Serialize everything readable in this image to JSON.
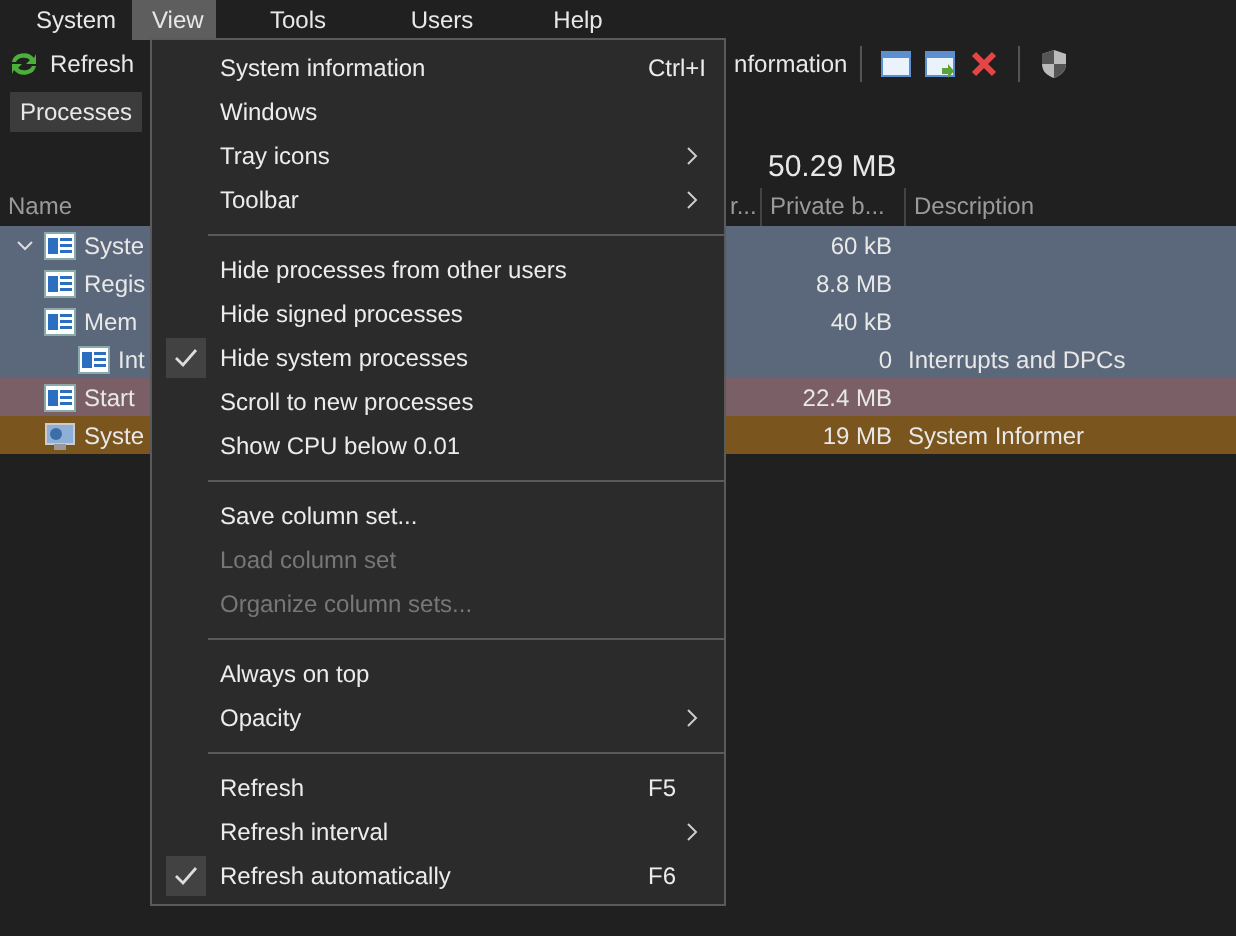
{
  "menu_bar": [
    {
      "label": "System",
      "selected": false
    },
    {
      "label": "View",
      "selected": true
    },
    {
      "label": "Tools",
      "selected": false
    },
    {
      "label": "Users",
      "selected": false
    },
    {
      "label": "Help",
      "selected": false
    }
  ],
  "toolbar": {
    "refresh": "Refresh",
    "info": "nformation"
  },
  "tabs": [
    {
      "label": "Processes",
      "selected": true
    }
  ],
  "table": {
    "summary": "50.29 MB",
    "columns": [
      "Name",
      "r...",
      "Private b...",
      "Description"
    ],
    "rows": [
      {
        "name": "Syste",
        "private": "60 kB",
        "color": "#5b677b",
        "expanded": true,
        "children": [
          {
            "name": "Regis",
            "private": "8.8 MB",
            "color": "#5b677b"
          },
          {
            "name": "Mem",
            "private": "40 kB",
            "color": "#5b677b",
            "children": [
              {
                "name": "Int",
                "private": "0",
                "description": "Interrupts and DPCs",
                "color": "#5b677b"
              }
            ]
          }
        ]
      },
      {
        "name": "Start",
        "private": "22.4 MB",
        "color": "#7a6066"
      },
      {
        "name": "Syste",
        "private": "19 MB",
        "description": "System Informer",
        "color": "#7a561e",
        "kind": "informer"
      }
    ]
  },
  "view_menu": [
    {
      "kind": "item",
      "label": "System information",
      "shortcut": "Ctrl+I",
      "checked": false,
      "disabled": false,
      "submenu": false
    },
    {
      "kind": "item",
      "label": "Windows",
      "checked": false,
      "disabled": false,
      "submenu": false
    },
    {
      "kind": "item",
      "label": "Tray icons",
      "checked": false,
      "disabled": false,
      "submenu": true
    },
    {
      "kind": "item",
      "label": "Toolbar",
      "checked": false,
      "disabled": false,
      "submenu": true
    },
    {
      "kind": "separator"
    },
    {
      "kind": "item",
      "label": "Hide processes from other users",
      "checked": false,
      "disabled": false,
      "submenu": false
    },
    {
      "kind": "item",
      "label": "Hide signed processes",
      "checked": false,
      "disabled": false,
      "submenu": false
    },
    {
      "kind": "item",
      "label": "Hide system processes",
      "checked": true,
      "disabled": false,
      "submenu": false
    },
    {
      "kind": "item",
      "label": "Scroll to new processes",
      "checked": false,
      "disabled": false,
      "submenu": false
    },
    {
      "kind": "item",
      "label": "Show CPU below 0.01",
      "checked": false,
      "disabled": false,
      "submenu": false
    },
    {
      "kind": "separator"
    },
    {
      "kind": "item",
      "label": "Save column set...",
      "checked": false,
      "disabled": false,
      "submenu": false
    },
    {
      "kind": "item",
      "label": "Load column set",
      "checked": false,
      "disabled": true,
      "submenu": false
    },
    {
      "kind": "item",
      "label": "Organize column sets...",
      "checked": false,
      "disabled": true,
      "submenu": false
    },
    {
      "kind": "separator"
    },
    {
      "kind": "item",
      "label": "Always on top",
      "checked": false,
      "disabled": false,
      "submenu": false
    },
    {
      "kind": "item",
      "label": "Opacity",
      "checked": false,
      "disabled": false,
      "submenu": true
    },
    {
      "kind": "separator"
    },
    {
      "kind": "item",
      "label": "Refresh",
      "shortcut": "F5",
      "checked": false,
      "disabled": false,
      "submenu": false
    },
    {
      "kind": "item",
      "label": "Refresh interval",
      "checked": false,
      "disabled": false,
      "submenu": true
    },
    {
      "kind": "item",
      "label": "Refresh automatically",
      "shortcut": "F6",
      "checked": true,
      "disabled": false,
      "submenu": false
    }
  ]
}
